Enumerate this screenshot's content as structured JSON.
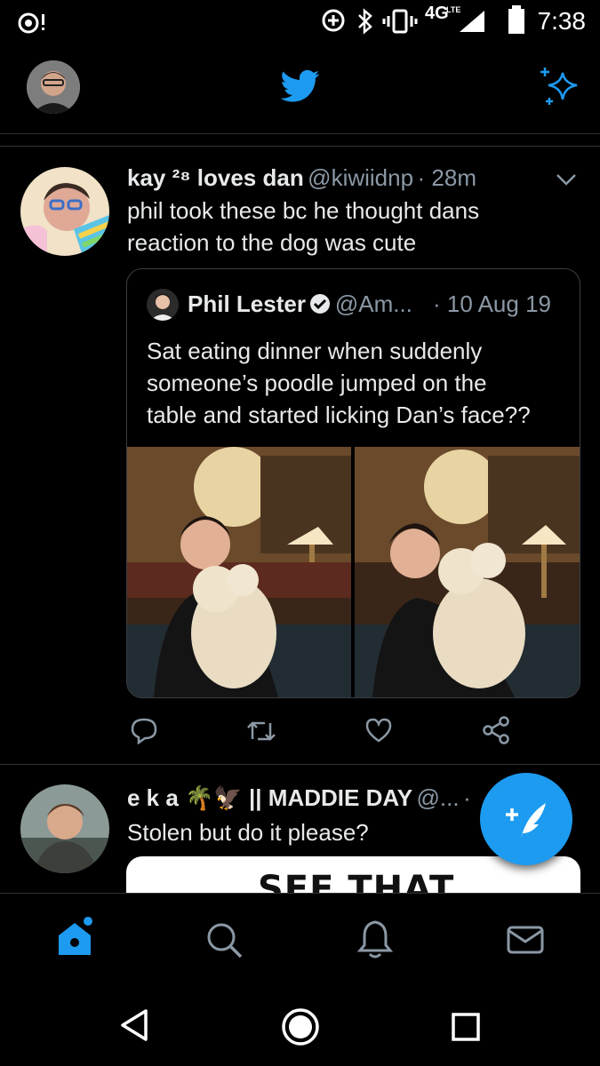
{
  "status_bar": {
    "time": "7:38",
    "network": "4G",
    "network_sub": "LTE"
  },
  "app": {
    "logo": "twitter-bird-icon"
  },
  "tweets": [
    {
      "name": "kay ²⁸ loves dan",
      "handle": "@kiwiidnp",
      "time": "· 28m",
      "text_lines": [
        "phil took these bc he thought dans",
        "reaction to the dog was cute"
      ],
      "quote": {
        "name": "Phil Lester",
        "handle": "@Am...",
        "date": "· 10 Aug 19",
        "text_lines": [
          "Sat eating dinner when suddenly",
          "someone’s poodle jumped on the",
          "table and started licking Dan’s face??"
        ]
      }
    },
    {
      "name": "e k a 🌴🦅 || MADDIE DAY",
      "handle": "@...",
      "time": "·",
      "text_lines": [
        "Stolen but do it please?"
      ],
      "image_text": "SEE THAT"
    }
  ],
  "colors": {
    "accent": "#1d9bf0",
    "background": "#000000",
    "secondary_text": "#8b98a5",
    "border": "#2f3336"
  }
}
